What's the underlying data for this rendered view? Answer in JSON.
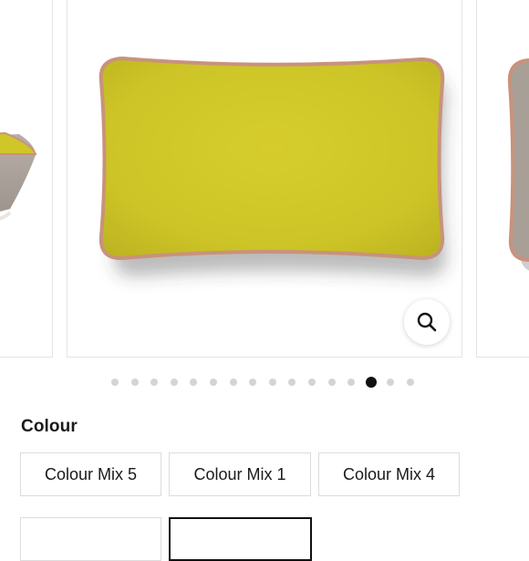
{
  "colors": {
    "pillow_fabric": "#cfc62a",
    "pillow_piping": "#c9927c",
    "neighbor_pillow": "#a89f97",
    "dot_active": "#111111",
    "dot_inactive": "#d4d4d4"
  },
  "carousel": {
    "slide_count": 16,
    "active_index": 13,
    "zoom_icon": "search-icon"
  },
  "colour_section": {
    "label": "Colour",
    "options": [
      {
        "label": "Colour Mix 5",
        "selected": false
      },
      {
        "label": "Colour Mix 1",
        "selected": false
      },
      {
        "label": "Colour Mix 4",
        "selected": false
      },
      {
        "label": "",
        "selected": false
      },
      {
        "label": "",
        "selected": true
      }
    ]
  }
}
